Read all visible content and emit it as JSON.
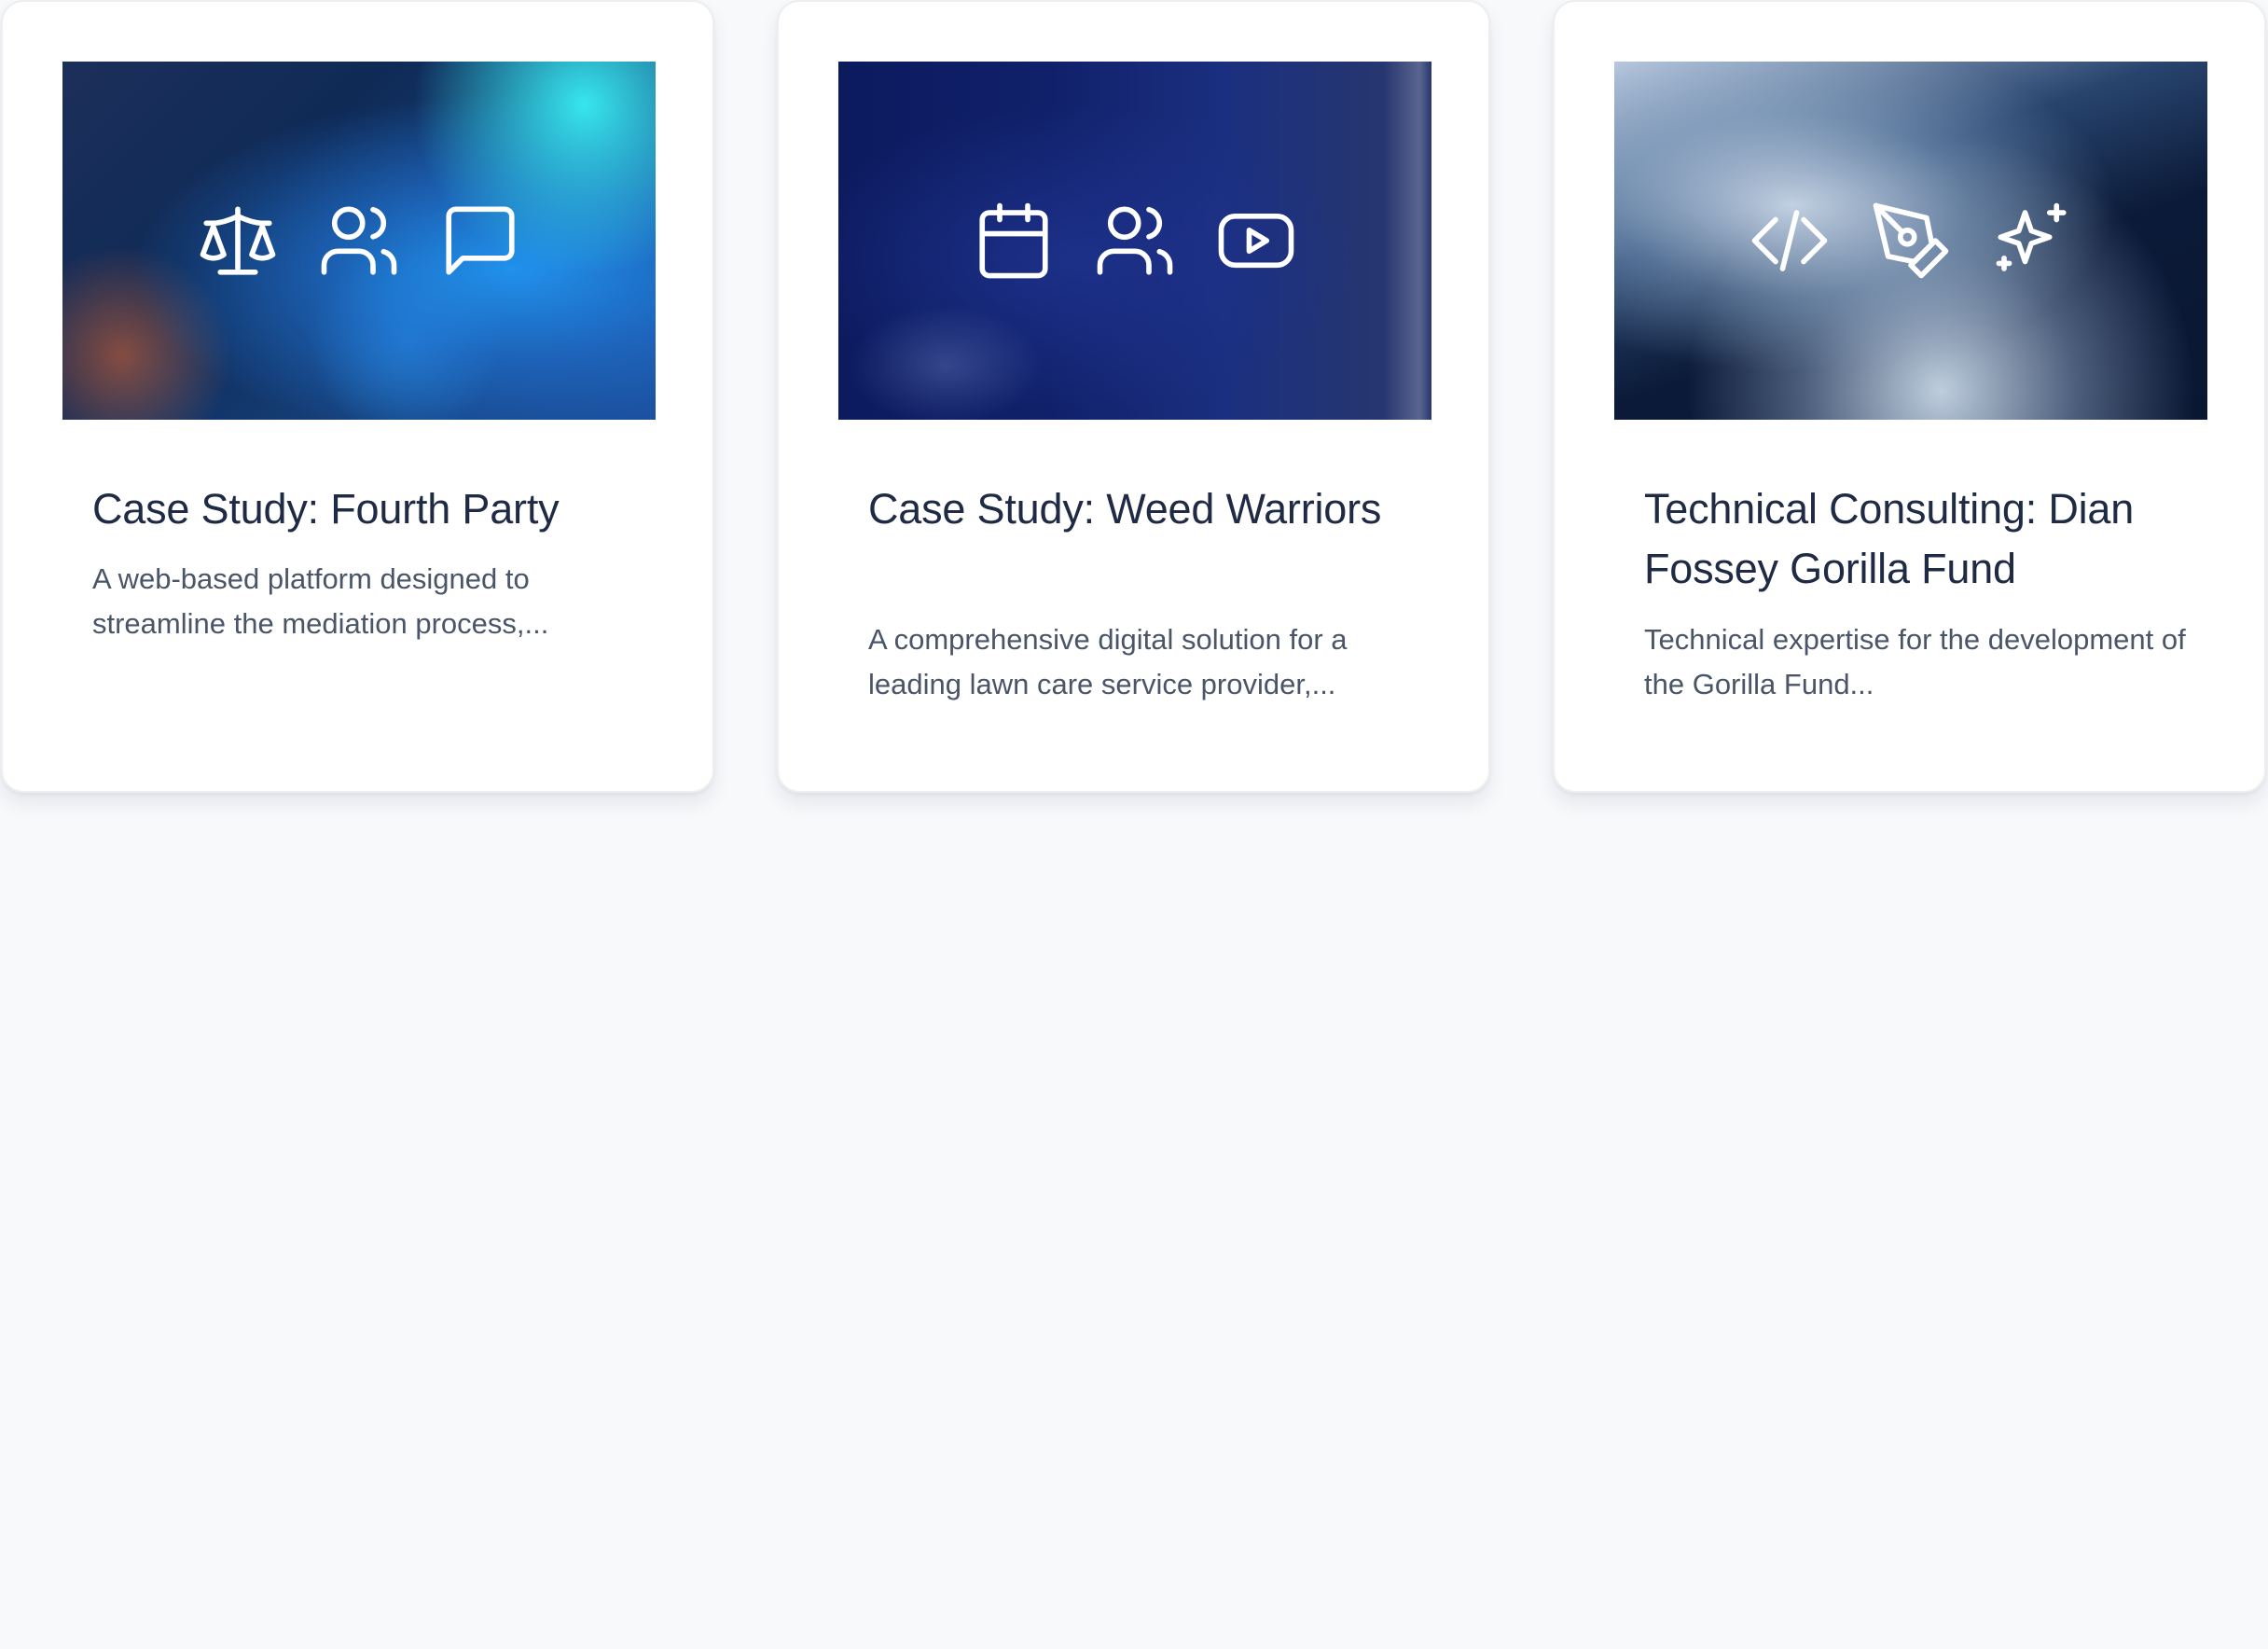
{
  "cards": [
    {
      "title": "Case Study: Fourth Party",
      "description": "A web-based platform designed to streamline the mediation process,...",
      "icons": [
        "scale-icon",
        "users-icon",
        "message-square-icon"
      ]
    },
    {
      "title": "Case Study: Weed Warriors",
      "description": "A comprehensive digital solution for a leading lawn care service provider,...",
      "icons": [
        "calendar-icon",
        "users-icon",
        "youtube-icon"
      ]
    },
    {
      "title": "Technical Consulting: Dian Fossey Gorilla Fund",
      "description": "Technical expertise for the development of the Gorilla Fund...",
      "icons": [
        "code-icon",
        "pen-tool-icon",
        "sparkles-icon"
      ]
    }
  ],
  "colors": {
    "page_background": "#f8f9fb",
    "card_background": "#ffffff",
    "title_text": "#1f2a44",
    "description_text": "#4a5568",
    "icon_stroke": "#ffffff"
  }
}
